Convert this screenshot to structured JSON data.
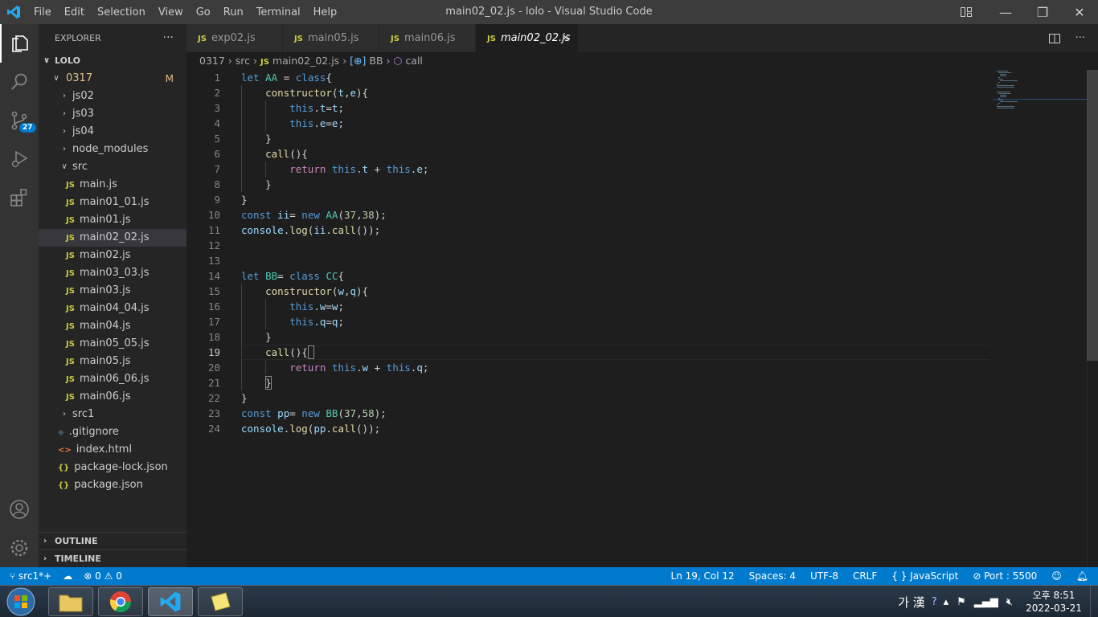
{
  "titlebar": {
    "menu": [
      "File",
      "Edit",
      "Selection",
      "View",
      "Go",
      "Run",
      "Terminal",
      "Help"
    ],
    "title": "main02_02.js - lolo - Visual Studio Code",
    "controls": {
      "minimize": "—",
      "maximize": "❐",
      "close": "✕"
    }
  },
  "activity_bar": {
    "source_control_badge": "27"
  },
  "sidebar": {
    "header": "EXPLORER",
    "more": "···",
    "root": "LOLO",
    "folder_0317": "0317",
    "folder_0317_badge": "M",
    "items": [
      {
        "label": "js02",
        "type": "folder"
      },
      {
        "label": "js03",
        "type": "folder"
      },
      {
        "label": "js04",
        "type": "folder"
      },
      {
        "label": "node_modules",
        "type": "folder"
      },
      {
        "label": "src",
        "type": "folder-open"
      },
      {
        "label": "main.js",
        "type": "js"
      },
      {
        "label": "main01_01.js",
        "type": "js"
      },
      {
        "label": "main01.js",
        "type": "js"
      },
      {
        "label": "main02_02.js",
        "type": "js",
        "selected": true
      },
      {
        "label": "main02.js",
        "type": "js"
      },
      {
        "label": "main03_03.js",
        "type": "js"
      },
      {
        "label": "main03.js",
        "type": "js"
      },
      {
        "label": "main04_04.js",
        "type": "js"
      },
      {
        "label": "main04.js",
        "type": "js"
      },
      {
        "label": "main05_05.js",
        "type": "js"
      },
      {
        "label": "main05.js",
        "type": "js"
      },
      {
        "label": "main06_06.js",
        "type": "js"
      },
      {
        "label": "main06.js",
        "type": "js"
      },
      {
        "label": "src1",
        "type": "folder"
      },
      {
        "label": ".gitignore",
        "type": "git"
      },
      {
        "label": "index.html",
        "type": "html"
      },
      {
        "label": "package-lock.json",
        "type": "json"
      },
      {
        "label": "package.json",
        "type": "json"
      }
    ],
    "outline": "OUTLINE",
    "timeline": "TIMELINE"
  },
  "tabs": [
    {
      "label": "exp02.js",
      "icon": "JS"
    },
    {
      "label": "main05.js",
      "icon": "JS"
    },
    {
      "label": "main06.js",
      "icon": "JS"
    },
    {
      "label": "main02_02.js",
      "icon": "JS",
      "active": true,
      "close": "✕"
    }
  ],
  "breadcrumb": {
    "p1": "0317",
    "p2": "src",
    "p3": "main02_02.js",
    "p4": "BB",
    "p5": "call",
    "js_icon": "JS",
    "sep": "›"
  },
  "editor": {
    "current_line": 19,
    "lines": [
      "let AA = class{",
      "    constructor(t,e){",
      "        this.t=t;",
      "        this.e=e;",
      "    }",
      "    call(){",
      "        return this.t + this.e;",
      "    }",
      "}",
      "const ii= new AA(37,38);",
      "console.log(ii.call());",
      "",
      "",
      "let BB= class CC{",
      "    constructor(w,q){",
      "        this.w=w;",
      "        this.q=q;",
      "    }",
      "    call(){",
      "        return this.w + this.q;",
      "    }",
      "}",
      "const pp= new BB(37,58);",
      "console.log(pp.call());"
    ]
  },
  "status_bar": {
    "branch": "src1*+",
    "errors": "0",
    "warnings": "0",
    "position": "Ln 19, Col 12",
    "spaces": "Spaces: 4",
    "encoding": "UTF-8",
    "eol": "CRLF",
    "language": "JavaScript",
    "port": "Port : 5500"
  },
  "taskbar": {
    "ime": "가 漢",
    "time": "오후 8:51",
    "date": "2022-03-21"
  }
}
